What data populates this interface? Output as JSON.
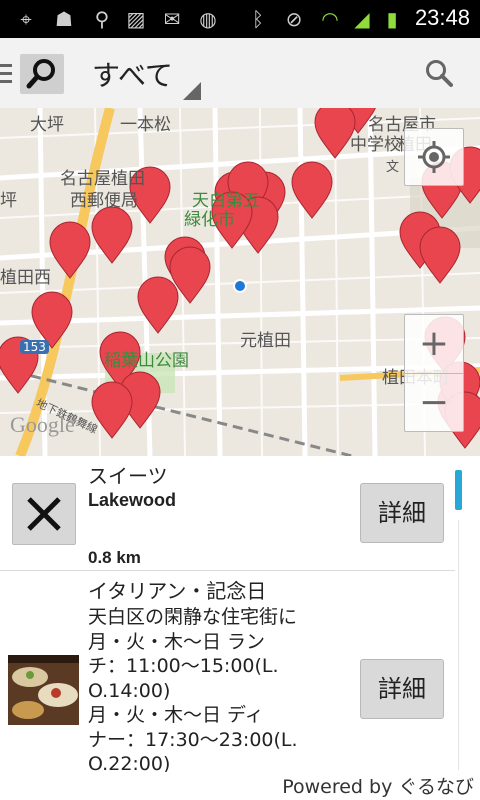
{
  "status_bar": {
    "time": "23:48",
    "icons": [
      "gps-icon",
      "android-debug-icon",
      "usb-icon",
      "image-warning-icon",
      "gmail-icon",
      "sync-icon",
      "bluetooth-icon",
      "mute-icon",
      "wifi-icon",
      "signal-icon",
      "battery-charging-icon"
    ]
  },
  "action_bar": {
    "title": "すべて",
    "icons": [
      "drawer-icon",
      "app-search-icon",
      "overflow-triangle-icon",
      "search-icon"
    ]
  },
  "map": {
    "labels": {
      "l1": "大坪",
      "l2": "一本松",
      "l3": "名古屋植田",
      "l4": "西郵便局",
      "l5": "天白第五",
      "l6": "緑化市",
      "l7": "植田西",
      "l8": "元植田",
      "l9": "稲葉山公園",
      "l10": "植田本町",
      "l11": "名古屋市",
      "l12": "中学校",
      "l13": "植田",
      "l14": "地下鉄鶴舞線",
      "l15": "文",
      "l16": "坪",
      "l17": "153",
      "logo": "Google"
    },
    "controls": {
      "locate": "my-location-icon",
      "zoom_in": "+",
      "zoom_out": "−"
    },
    "marker_color": "#e8454f"
  },
  "results": [
    {
      "genre": "スイーツ",
      "name": "Lakewood",
      "distance": "0.8 km",
      "detail_label": "詳細",
      "close_icon": "close-icon"
    },
    {
      "genre": "イタリアン・記念日",
      "desc_lines": [
        "天白区の閑静な住宅街に",
        "月・火・木～日 ラン",
        "チ：11:00～15:00(L.",
        "O.14:00)",
        "月・火・木～日 ディ",
        "ナー：17:30～23:00(L.",
        "O.22:00)"
      ],
      "detail_label": "詳細"
    }
  ],
  "footer": {
    "powered": "Powered by ぐるなび"
  },
  "colors": {
    "accent": "#29a8d8",
    "actionbar_bg": "#f2f2f2",
    "marker": "#e8454f"
  }
}
